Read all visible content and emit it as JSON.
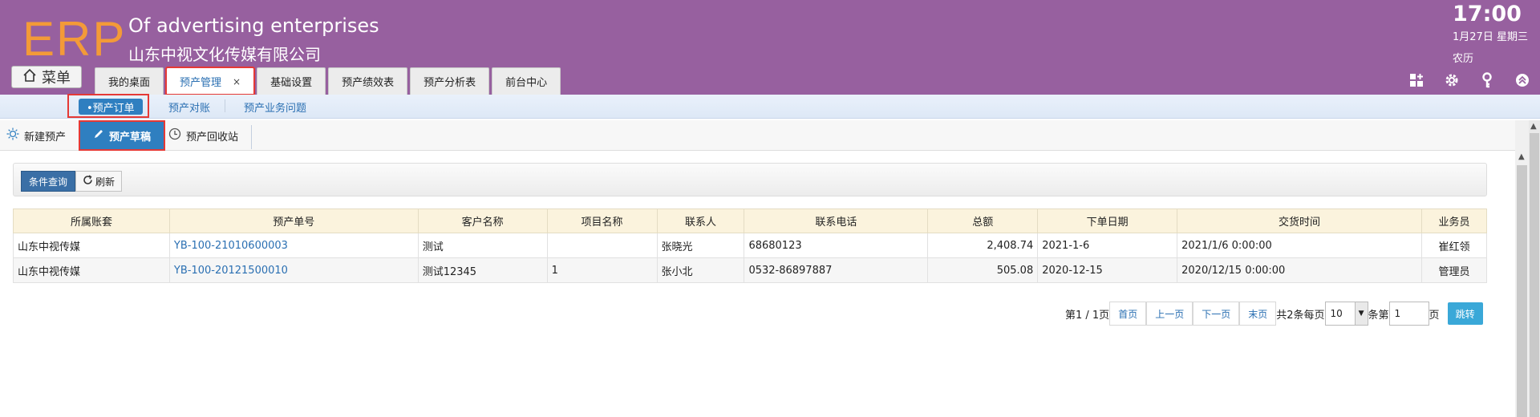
{
  "header": {
    "logo": "ERP",
    "company_en": "Of advertising enterprises",
    "company_cn": "山东中视文化传媒有限公司",
    "time": "17:00",
    "date": "1月27日 星期三",
    "lunar": "农历",
    "bg_color": "#97609f",
    "logo_color": "#f39a38"
  },
  "menu_button": {
    "label": "菜单",
    "icon": "home-icon"
  },
  "tabs": [
    {
      "label": "我的桌面"
    },
    {
      "label": "预产管理",
      "close": "×"
    },
    {
      "label": "基础设置"
    },
    {
      "label": "预产绩效表"
    },
    {
      "label": "预产分析表"
    },
    {
      "label": "前台中心"
    }
  ],
  "header_icons": [
    "grid-add-icon",
    "gear-icon",
    "key-icon",
    "collapse-icon"
  ],
  "subnav": {
    "items": [
      {
        "label": "•预产订单"
      },
      {
        "label": "预产对账"
      },
      {
        "label": "预产业务问题"
      }
    ]
  },
  "toolbar": {
    "items": [
      {
        "label": "新建预产",
        "icon": "sun-icon"
      },
      {
        "label": "预产草稿",
        "icon": "pencil-icon"
      },
      {
        "label": "预产回收站",
        "icon": "clock-icon"
      }
    ]
  },
  "filter": {
    "query_label": "条件查询",
    "refresh_label": "刷新"
  },
  "table": {
    "columns": [
      "所属账套",
      "预产单号",
      "客户名称",
      "项目名称",
      "联系人",
      "联系电话",
      "总额",
      "下单日期",
      "交货时间",
      "业务员"
    ],
    "rows": [
      [
        "山东中视传媒",
        "YB-100-21010600003",
        "测试",
        "",
        "张晓光",
        "68680123",
        "2,408.74",
        "2021-1-6",
        "2021/1/6 0:00:00",
        "崔红领"
      ],
      [
        "山东中视传媒",
        "YB-100-20121500010",
        "测试12345",
        "1",
        "张小北",
        "0532-86897887",
        "505.08",
        "2020-12-15",
        "2020/12/15 0:00:00",
        "管理员"
      ]
    ]
  },
  "pager": {
    "page_info": "第1 / 1页",
    "first": "首页",
    "prev": "上一页",
    "next": "下一页",
    "last": "末页",
    "total_text": "共2条每页",
    "page_size": "10",
    "unit": "条第",
    "page_num": "1",
    "page_suffix": "页",
    "jump": "跳转"
  }
}
